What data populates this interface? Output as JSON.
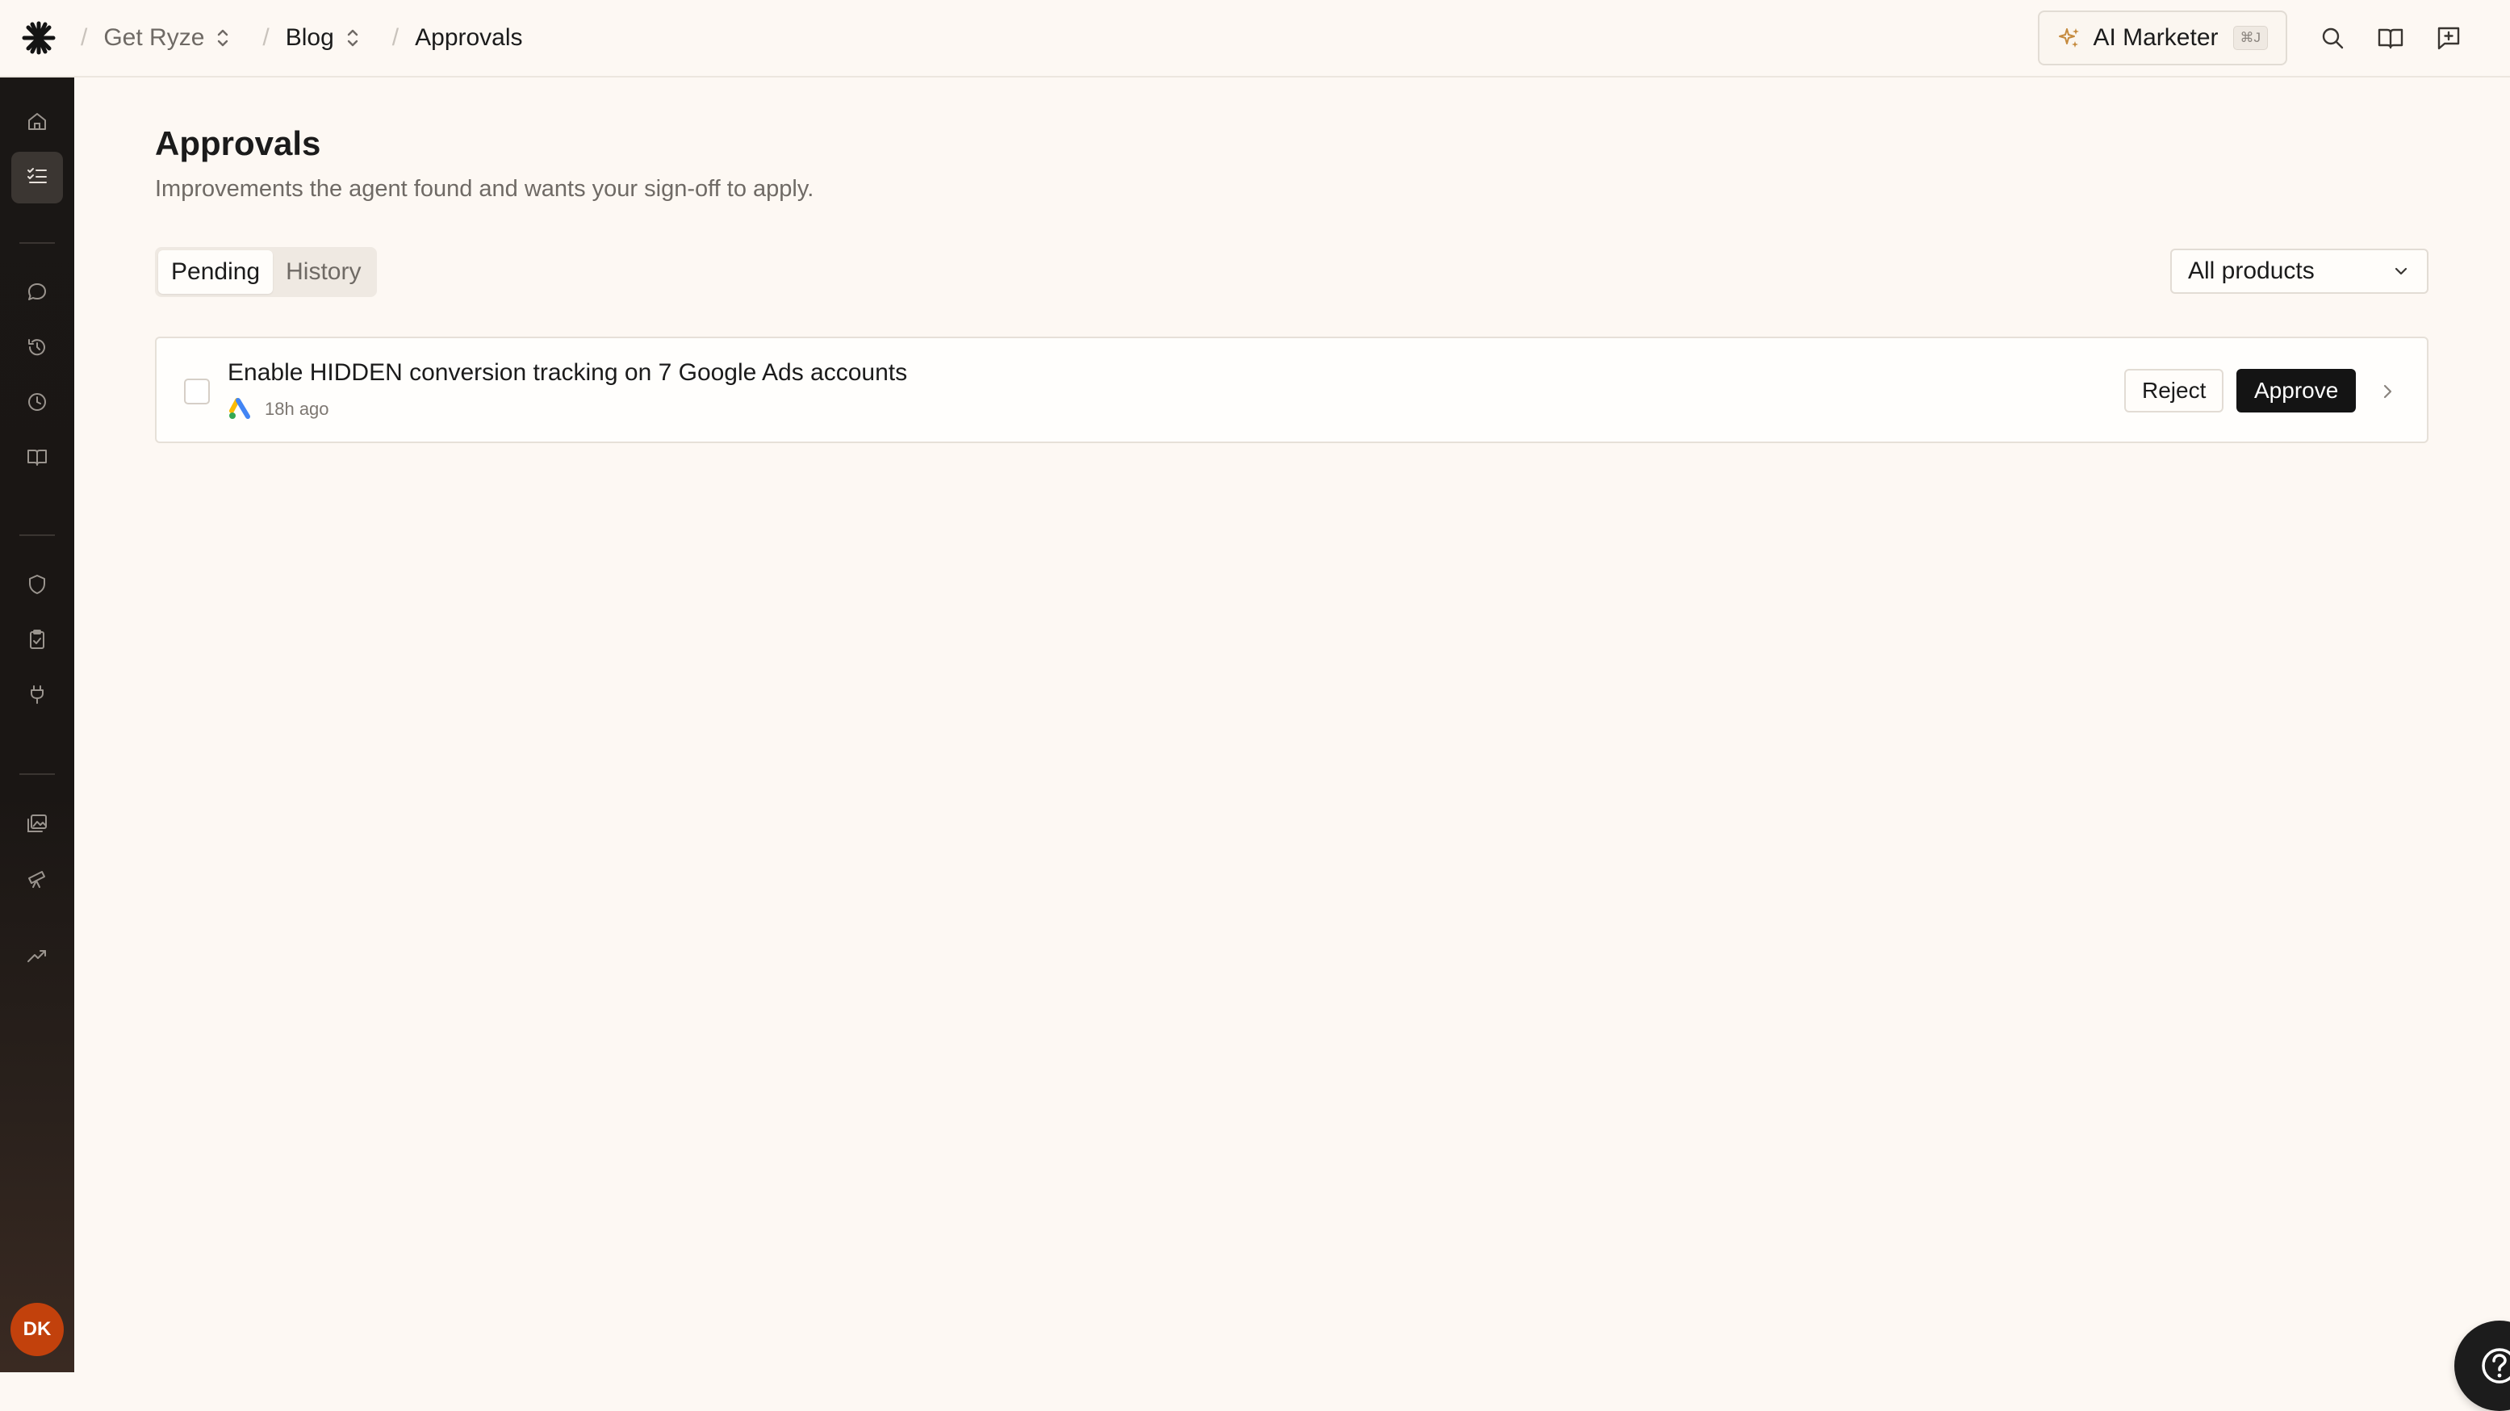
{
  "breadcrumb": {
    "items": [
      {
        "label": "Get Ryze"
      },
      {
        "label": "Blog"
      },
      {
        "label": "Approvals"
      }
    ]
  },
  "topbar": {
    "ai_button_label": "AI Marketer",
    "ai_shortcut": "⌘J",
    "icons": [
      "search-icon",
      "book-open-icon",
      "message-plus-icon"
    ]
  },
  "sidebar": {
    "items": [
      {
        "icon": "home-icon"
      },
      {
        "icon": "list-check-icon",
        "active": true
      },
      {
        "icon": "chat-bubble-icon"
      },
      {
        "icon": "history-icon"
      },
      {
        "icon": "clock-icon"
      },
      {
        "icon": "book-icon"
      },
      {
        "icon": "shield-icon"
      },
      {
        "icon": "clipboard-check-icon"
      },
      {
        "icon": "plug-icon"
      },
      {
        "icon": "images-icon"
      },
      {
        "icon": "telescope-icon"
      },
      {
        "icon": "trending-up-icon"
      }
    ],
    "avatar_initials": "DK"
  },
  "page": {
    "title": "Approvals",
    "subtitle": "Improvements the agent found and wants your sign-off to apply."
  },
  "tabs": [
    {
      "label": "Pending",
      "active": true
    },
    {
      "label": "History",
      "active": false
    }
  ],
  "filter": {
    "selected": "All products"
  },
  "approvals": [
    {
      "title": "Enable HIDDEN conversion tracking on 7 Google Ads accounts",
      "platform_icon": "google-ads-icon",
      "time": "18h ago",
      "reject_label": "Reject",
      "approve_label": "Approve"
    }
  ],
  "help_icon": "help-circle-icon",
  "colors": {
    "background": "#fdf8f3",
    "sidebar": "#1a1715",
    "approve_button": "#141414",
    "avatar": "#c2410c",
    "ai_sparkle": "#c58a3d"
  }
}
